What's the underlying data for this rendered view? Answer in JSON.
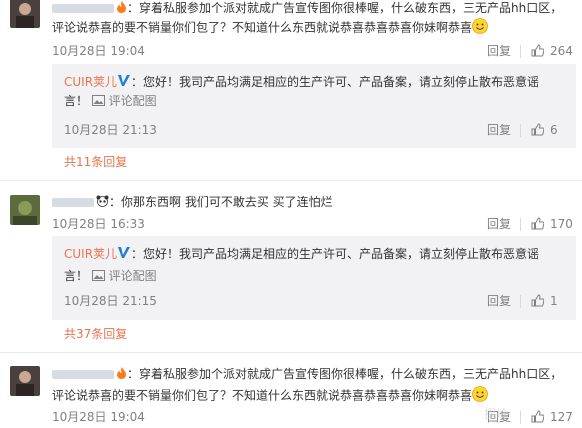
{
  "comments": [
    {
      "text_line1": "：穿着私服参加个派对就成广告宣传图你很棒喔，什么破东西，三无产品hh口区，",
      "text_line2": "评论说恭喜的要不销量你们包了？不知道什么东西就说恭喜恭喜恭喜你妹啊恭喜",
      "time": "10月28日 19:04",
      "reply_label": "回复",
      "likes": "264",
      "replies": [
        {
          "author": "CUIR荚儿",
          "text_line1": "：您好！我司产品均满足相应的生产许可、产品备案，请立刻停止散布恶意谣",
          "text_line2": "言！",
          "cfg_label": "评论配图",
          "time": "10月28日 21:13",
          "reply_label": "回复",
          "likes": "6"
        }
      ],
      "more_label": "共11条回复"
    },
    {
      "text_line1": "：你那东西啊 我们可不敢去买 买了连怕烂",
      "time": "10月28日 16:33",
      "reply_label": "回复",
      "likes": "170",
      "replies": [
        {
          "author": "CUIR荚儿",
          "text_line1": "：您好！我司产品均满足相应的生产许可、产品备案，请立刻停止散布恶意谣",
          "text_line2": "言！",
          "cfg_label": "评论配图",
          "time": "10月28日 21:15",
          "reply_label": "回复",
          "likes": "1"
        }
      ],
      "more_label": "共37条回复"
    },
    {
      "text_line1": "：穿着私服参加个派对就成广告宣传图你很棒喔，什么破东西，三无产品hh口区，",
      "text_line2": "评论说恭喜的要不销量你们包了？不知道什么东西就说恭喜恭喜恭喜你妹啊恭喜",
      "time": "10月28日 19:04",
      "reply_label": "回复",
      "likes": "127"
    }
  ],
  "colors": {
    "link": "#eb7350",
    "verified": "#1f7cd6",
    "reply_bg": "#f2f2f5",
    "meta": "#808080"
  },
  "watermark": "探岭"
}
